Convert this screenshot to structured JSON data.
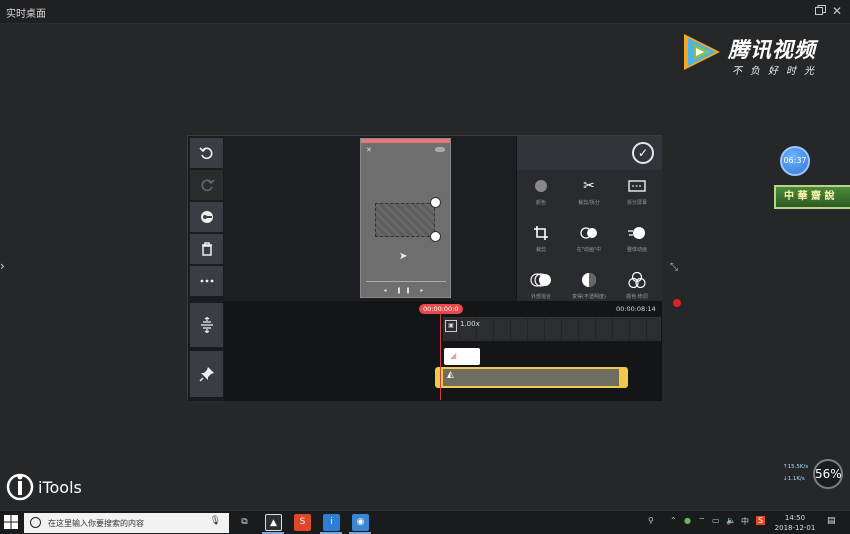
{
  "window": {
    "title": "实时桌面"
  },
  "brand": {
    "name": "腾讯视频",
    "slogan": "不负好时光"
  },
  "widgets": {
    "timer": "06:37",
    "badge": "中 華 齋 說"
  },
  "editor": {
    "timeline": {
      "current_time": "00:00:00:0",
      "total_time": "00:00:08:14",
      "speed": "1.00x"
    },
    "effect_tools": [
      {
        "label": "颜色",
        "icon": "color-dot-icon"
      },
      {
        "label": "裁剪/拆分",
        "icon": "scissors-icon"
      },
      {
        "label": "拆分屏幕",
        "icon": "split-screen-icon"
      },
      {
        "label": "裁剪",
        "icon": "crop-icon"
      },
      {
        "label": "在\"动画\"中",
        "icon": "in-animation-icon"
      },
      {
        "label": "整体动画",
        "icon": "overall-animation-icon"
      },
      {
        "label": "外部混合",
        "icon": "blend-icon"
      },
      {
        "label": "变得(不透明度)",
        "icon": "opacity-icon"
      },
      {
        "label": "颜色·修调",
        "icon": "color-adjust-icon"
      }
    ]
  },
  "itools": {
    "label": "iTools"
  },
  "network": {
    "up": "15.5K/s",
    "down": "1.1K/s",
    "percent": "56%"
  },
  "taskbar": {
    "search_placeholder": "在这里输入你要搜索的内容",
    "ime": "中",
    "time": "14:50",
    "date": "2018-12-01"
  },
  "colors": {
    "accent_red": "#e84a4a",
    "clip_yellow": "#f1c94a",
    "bg": "#262729"
  }
}
